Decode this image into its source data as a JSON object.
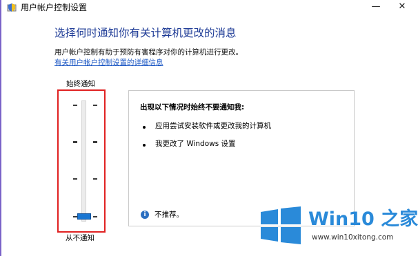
{
  "window": {
    "title": "用户帐户控制设置",
    "icon": "uac-shield-icon"
  },
  "controls": {
    "minimize": "—",
    "close": "✕"
  },
  "main": {
    "heading": "选择何时通知你有关计算机更改的消息",
    "description": "用户帐户控制有助于预防有害程序对你的计算机进行更改。",
    "link": "有关用户帐户控制设置的详细信息"
  },
  "slider": {
    "top_label": "始终通知",
    "bottom_label": "从不通知",
    "levels": 4,
    "selected_level": 0,
    "highlight_color": "#e02020",
    "thumb_color": "#1976d2"
  },
  "panel": {
    "title": "出现以下情况时始终不要通知我:",
    "items": [
      "应用尝试安装软件或更改我的计算机",
      "我更改了 Windows 设置"
    ],
    "info_text": "不推荐。"
  },
  "watermark": {
    "title": "Win10 之家",
    "url": "www.win10xitong.com",
    "color": "#2a8ad9"
  }
}
